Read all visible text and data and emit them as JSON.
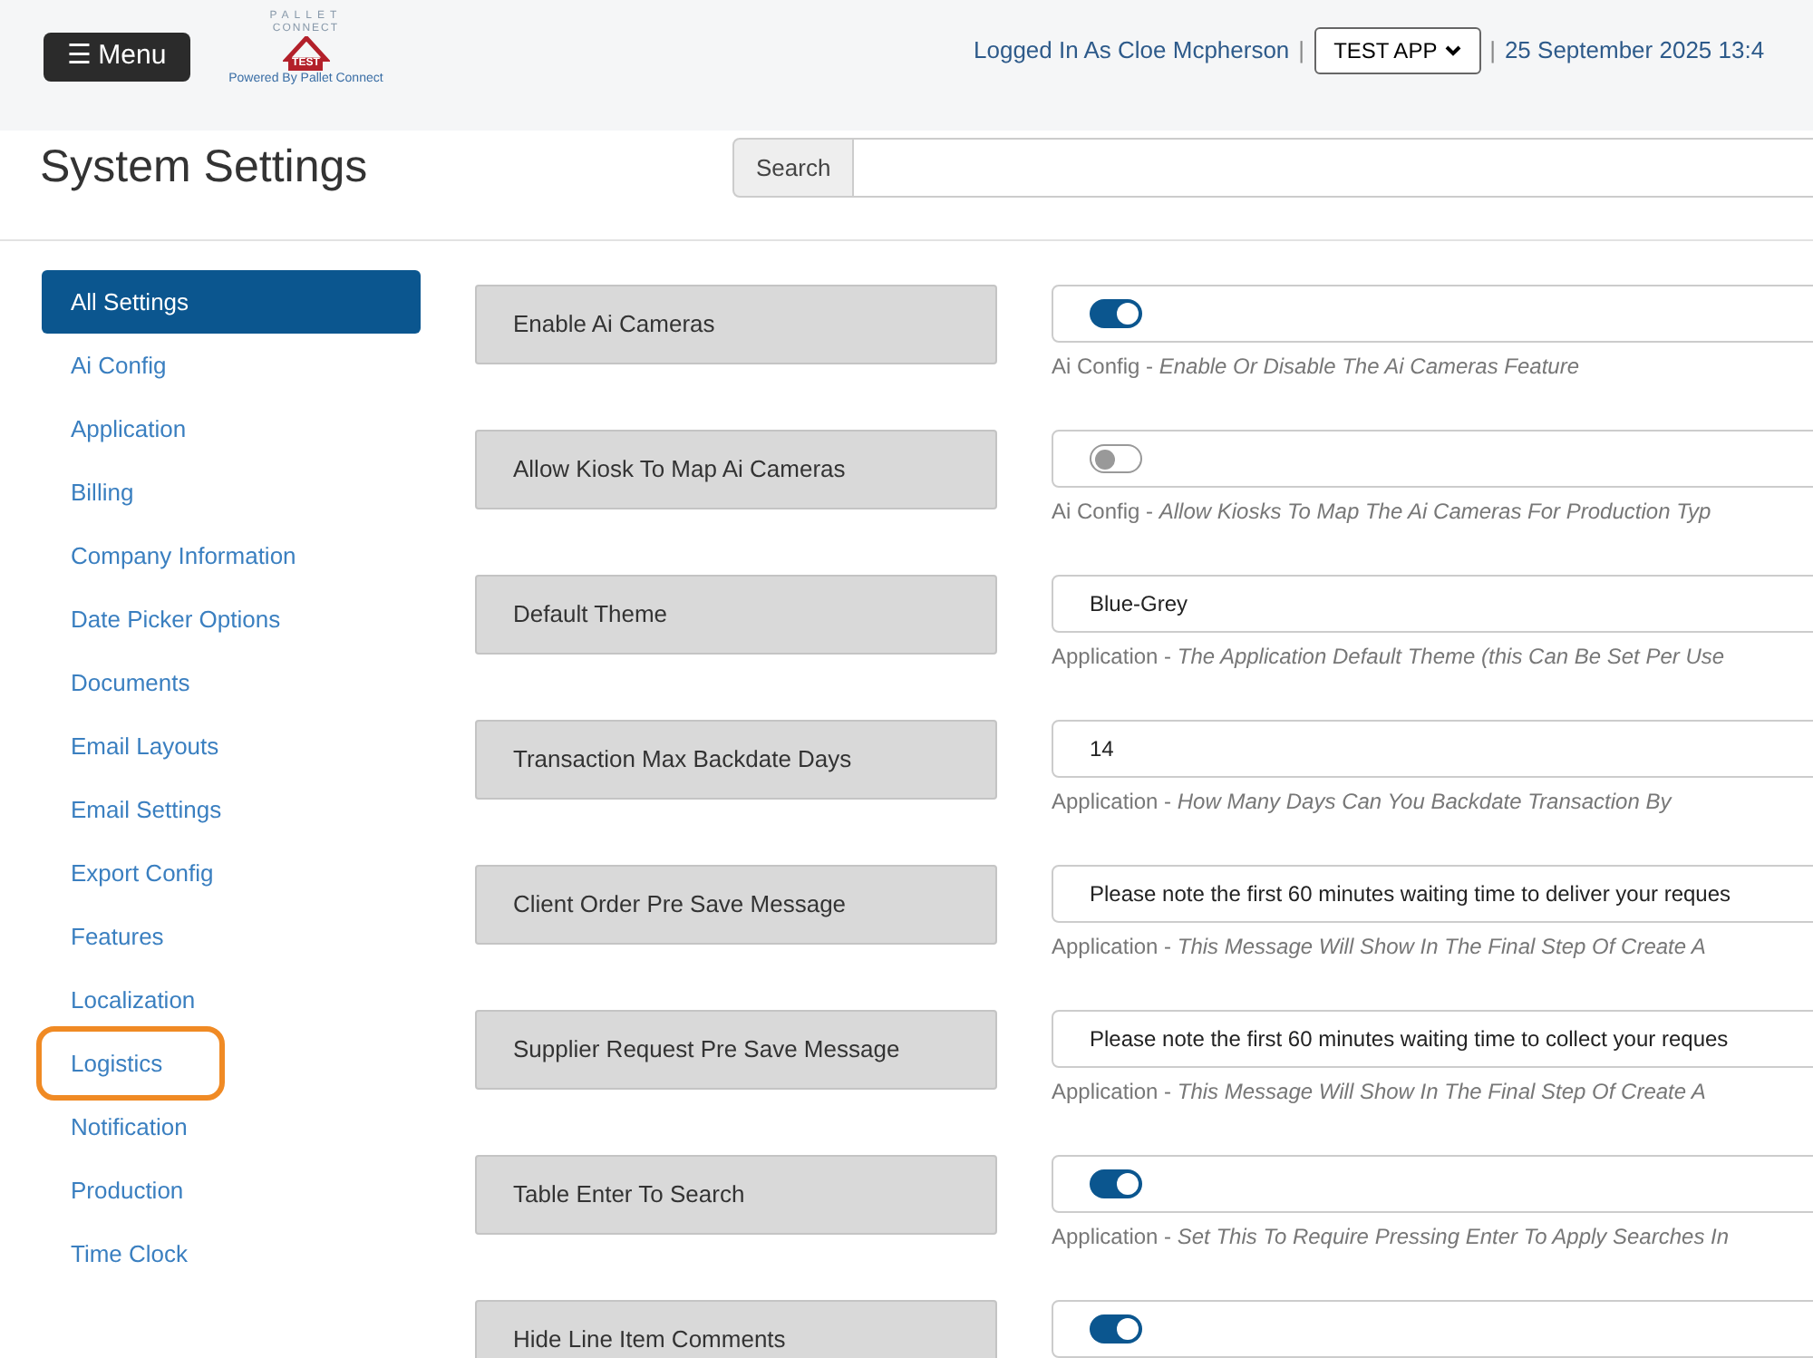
{
  "header": {
    "menu_button": "☰ Menu",
    "logo": {
      "line_1": "PALLET",
      "line_2": "CONNECT",
      "badge": "TEST",
      "tagline": "Powered By Pallet Connect"
    },
    "logged_in": "Logged In As Cloe Mcpherson",
    "separator_1": "|",
    "app_select": "TEST APP",
    "separator_2": "|",
    "datetime": "25 September 2025 13:4"
  },
  "page_title": "System Settings",
  "search": {
    "label": "Search"
  },
  "sidebar": {
    "items": [
      {
        "label": "All Settings",
        "selected": true,
        "highlighted": false
      },
      {
        "label": "Ai Config",
        "selected": false,
        "highlighted": false
      },
      {
        "label": "Application",
        "selected": false,
        "highlighted": false
      },
      {
        "label": "Billing",
        "selected": false,
        "highlighted": false
      },
      {
        "label": "Company Information",
        "selected": false,
        "highlighted": false
      },
      {
        "label": "Date Picker Options",
        "selected": false,
        "highlighted": false
      },
      {
        "label": "Documents",
        "selected": false,
        "highlighted": false
      },
      {
        "label": "Email Layouts",
        "selected": false,
        "highlighted": false
      },
      {
        "label": "Email Settings",
        "selected": false,
        "highlighted": false
      },
      {
        "label": "Export Config",
        "selected": false,
        "highlighted": false
      },
      {
        "label": "Features",
        "selected": false,
        "highlighted": false
      },
      {
        "label": "Localization",
        "selected": false,
        "highlighted": false
      },
      {
        "label": "Logistics",
        "selected": false,
        "highlighted": true
      },
      {
        "label": "Notification",
        "selected": false,
        "highlighted": false
      },
      {
        "label": "Production",
        "selected": false,
        "highlighted": false
      },
      {
        "label": "Time Clock",
        "selected": false,
        "highlighted": false
      }
    ]
  },
  "settings": [
    {
      "label": "Enable Ai Cameras",
      "kind": "toggle",
      "on": true,
      "hint": "Ai Config - *Enable Or Disable The Ai Cameras Feature*"
    },
    {
      "label": "Allow Kiosk To Map Ai Cameras",
      "kind": "toggle",
      "on": false,
      "hint": "Ai Config - *Allow Kiosks To Map The Ai Cameras For Production Typ*"
    },
    {
      "label": "Default Theme",
      "kind": "text",
      "value": "Blue-Grey",
      "hint": "Application - *The Application Default Theme (this Can Be Set Per Use*"
    },
    {
      "label": "Transaction Max Backdate Days",
      "kind": "text",
      "value": "14",
      "hint": "Application - *How Many Days Can You Backdate Transaction By*"
    },
    {
      "label": "Client Order Pre Save Message",
      "kind": "text",
      "value": "Please note the first 60 minutes waiting time to deliver your reques",
      "hint": "Application - *This Message Will Show In The Final Step Of Create A*"
    },
    {
      "label": "Supplier Request Pre Save Message",
      "kind": "text",
      "value": "Please note the first 60 minutes waiting time to collect your reques",
      "hint": "Application - *This Message Will Show In The Final Step Of Create A*"
    },
    {
      "label": "Table Enter To Search",
      "kind": "toggle",
      "on": true,
      "hint": "Application - *Set This To Require Pressing Enter To Apply Searches In*"
    },
    {
      "label": "Hide Line Item Comments",
      "kind": "toggle",
      "on": true
    }
  ]
}
